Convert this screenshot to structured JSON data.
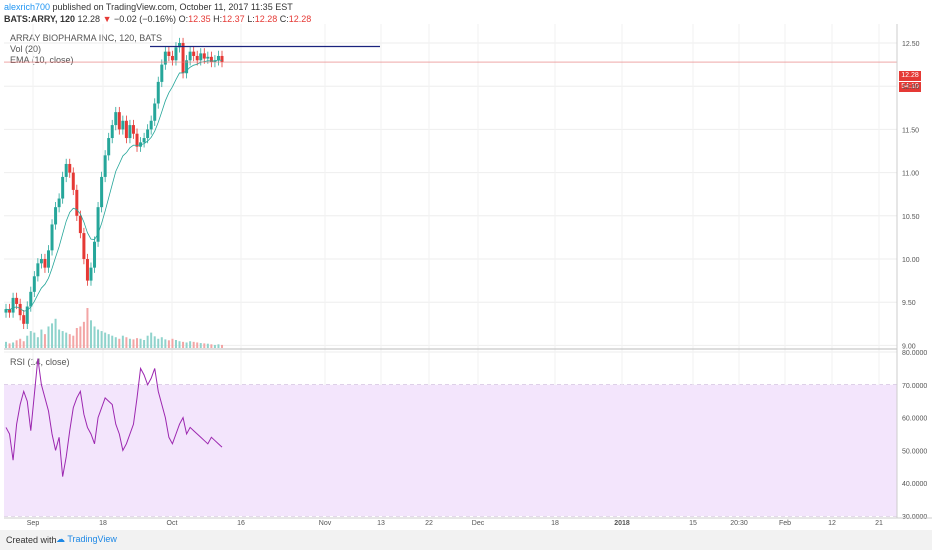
{
  "header": {
    "author": "alexrich700",
    "published_text": "published on TradingView.com, October 11, 2017 11:35 EST",
    "symbol": "BATS:ARRY, 120",
    "last": "12.28",
    "change_arrow": "▼",
    "change": "−0.02 (−0.16%)",
    "o_label": "O:",
    "o_value": "12.35",
    "h_label": "H:",
    "h_value": "12.37",
    "l_label": "L:",
    "l_value": "12.28",
    "c_label": "C:",
    "c_value": "12.28"
  },
  "legend": {
    "title": "ARRAY BIOPHARMA INC, 120, BATS",
    "vol": "Vol (20)",
    "ema": "EMA (10, close)",
    "rsi": "RSI (14, close)"
  },
  "price_tags": {
    "price": "12.28",
    "countdown": "54:10"
  },
  "footer": {
    "created_with": "Created with",
    "brand": "TradingView"
  },
  "colors": {
    "up": "#26a69a",
    "down": "#e53935",
    "ema": "#26a69a",
    "rsi": "#9c27b0",
    "rsi_band": "#f3e5fc",
    "hline": "#1a237e",
    "price_line": "#e57373"
  },
  "chart_data": [
    {
      "type": "candlestick",
      "title": "ARRAY BIOPHARMA INC, 120, BATS",
      "ylim": [
        8.97,
        12.72
      ],
      "y_ticks": [
        "12.50",
        "12.00",
        "11.50",
        "11.00",
        "10.50",
        "10.00",
        "9.50",
        "9.00"
      ],
      "x_ticks": [
        "Sep",
        "18",
        "Oct",
        "16",
        "Nov",
        "13",
        "22",
        "Dec",
        "18",
        "2018",
        "15",
        "20:30",
        "Feb",
        "12",
        "21"
      ],
      "horizontal_line": 12.46,
      "last_price": 12.28,
      "close": [
        9.42,
        9.38,
        9.55,
        9.48,
        9.35,
        9.25,
        9.45,
        9.62,
        9.8,
        9.95,
        10.0,
        9.9,
        10.1,
        10.4,
        10.6,
        10.7,
        10.95,
        11.1,
        11.0,
        10.8,
        10.5,
        10.3,
        10.0,
        9.75,
        9.9,
        10.2,
        10.6,
        10.95,
        11.2,
        11.4,
        11.55,
        11.7,
        11.5,
        11.6,
        11.4,
        11.55,
        11.45,
        11.3,
        11.35,
        11.4,
        11.5,
        11.6,
        11.8,
        12.05,
        12.25,
        12.4,
        12.35,
        12.3,
        12.45,
        12.5,
        12.15,
        12.3,
        12.4,
        12.35,
        12.3,
        12.38,
        12.32,
        12.34,
        12.28,
        12.3,
        12.35,
        12.28
      ],
      "volume": [
        20,
        15,
        18,
        25,
        30,
        22,
        40,
        55,
        50,
        35,
        60,
        45,
        70,
        80,
        95,
        60,
        55,
        50,
        45,
        40,
        65,
        70,
        85,
        130,
        90,
        70,
        60,
        55,
        50,
        45,
        40,
        35,
        30,
        40,
        35,
        30,
        28,
        32,
        30,
        26,
        40,
        50,
        38,
        30,
        35,
        28,
        25,
        30,
        26,
        22,
        20,
        18,
        22,
        20,
        18,
        16,
        15,
        14,
        12,
        10,
        12,
        10
      ],
      "volume_unit": "relative"
    },
    {
      "type": "line",
      "title": "RSI (14, close)",
      "ylim": [
        30,
        80
      ],
      "y_ticks": [
        "80.0000",
        "70.0000",
        "60.0000",
        "50.0000",
        "40.0000",
        "30.0000"
      ],
      "band": [
        30,
        70
      ],
      "series": [
        {
          "values": [
            57,
            55,
            47,
            58,
            64,
            68,
            65,
            56,
            67,
            78,
            70,
            66,
            62,
            55,
            50,
            54,
            42,
            48,
            56,
            63,
            66,
            68,
            61,
            57,
            55,
            52,
            60,
            63,
            66,
            65,
            64,
            58,
            55,
            50,
            52,
            55,
            58,
            66,
            75,
            73,
            70,
            72,
            75,
            68,
            64,
            60,
            54,
            52,
            55,
            58,
            60,
            55,
            57,
            56,
            55,
            54,
            53,
            52,
            54,
            53,
            52,
            51
          ]
        }
      ]
    }
  ]
}
